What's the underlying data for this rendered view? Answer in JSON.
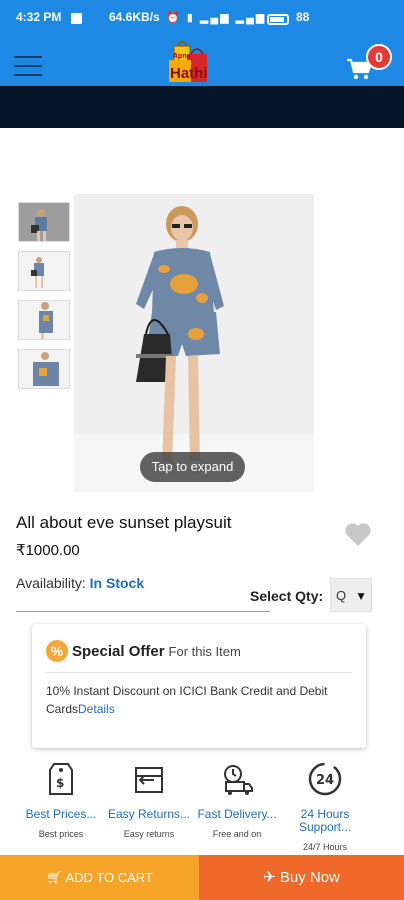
{
  "status_bar": {
    "time": "4:32 PM",
    "network_speed": "64.6KB/s",
    "battery": "88"
  },
  "header": {
    "logo_text_top": "Apna",
    "logo_text_main": "Hathi",
    "cart_count": "0",
    "accent_color": "#1e88e5"
  },
  "product": {
    "title": "All about eve sunset playsuit",
    "price": "₹1000.00",
    "availability_label": "Availability:",
    "availability_value": "In Stock",
    "qty_label": "Select Qty:",
    "qty_value": "Q",
    "tap_to_expand": "Tap to expand",
    "thumbnail_count": 4
  },
  "offer": {
    "badge_symbol": "%",
    "title": "Special Offer",
    "subtitle": "For this Item",
    "description": "10% Instant Discount on ICICI Bank Credit and Debit Cards",
    "details_link": "Details"
  },
  "features": [
    {
      "icon": "price-tag-icon",
      "name": "Best Prices...",
      "sub": "Best prices"
    },
    {
      "icon": "return-box-icon",
      "name": "Easy Returns...",
      "sub": "Easy returns"
    },
    {
      "icon": "delivery-truck-icon",
      "name": "Fast Delivery...",
      "sub": "Free and on"
    },
    {
      "icon": "24-hours-icon",
      "name": "24 Hours Support...",
      "sub": "24/7 Hours"
    }
  ],
  "actions": {
    "add_to_cart": "ADD TO CART",
    "buy_now": "Buy Now",
    "cart_color": "#f7a52a",
    "buy_color": "#f0692a"
  }
}
